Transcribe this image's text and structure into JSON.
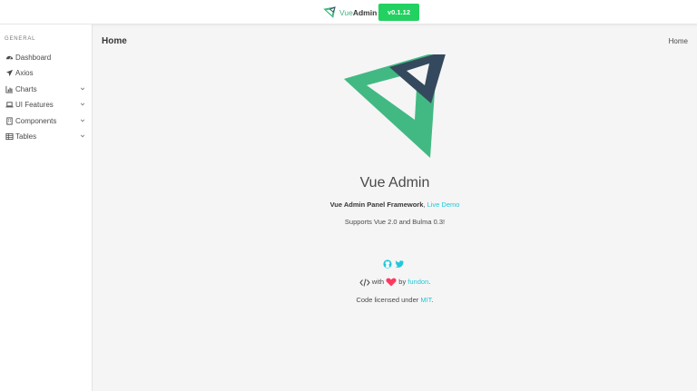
{
  "header": {
    "brand_prefix": "Vue",
    "brand_suffix": "Admin",
    "version": "v0.1.12"
  },
  "sidebar": {
    "label": "GENERAL",
    "items": [
      {
        "label": "Dashboard",
        "icon": "dashboard-icon"
      },
      {
        "label": "Axios",
        "icon": "rocket-icon"
      },
      {
        "label": "Charts",
        "icon": "bar-chart-icon",
        "expandable": true
      },
      {
        "label": "UI Features",
        "icon": "laptop-icon",
        "expandable": true
      },
      {
        "label": "Components",
        "icon": "building-icon",
        "expandable": true
      },
      {
        "label": "Tables",
        "icon": "table-icon",
        "expandable": true
      }
    ]
  },
  "main": {
    "page_title": "Home",
    "breadcrumb": "Home",
    "hero": {
      "title": "Vue Admin",
      "subtitle_strong": "Vue Admin Panel Framework",
      "subtitle_sep": ",",
      "live_demo": "Live Demo",
      "support": "Supports Vue 2.0 and Bulma 0.3!"
    },
    "footer": {
      "made_with": "with",
      "by": "by",
      "author": "fundon",
      "author_dot": ".",
      "license_text": "Code licensed under",
      "license_link": "MIT",
      "license_dot": "."
    }
  },
  "colors": {
    "accent_green": "#42b983",
    "dark_slate": "#35495e",
    "link": "#1fc8db",
    "badge_green": "#23d160",
    "heart": "#ff3860"
  }
}
